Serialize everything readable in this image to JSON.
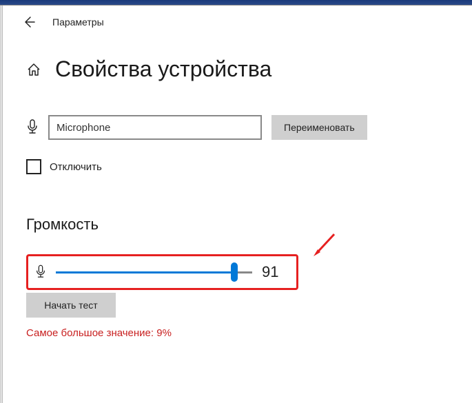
{
  "header": {
    "back_icon": "arrow-left",
    "title": "Параметры"
  },
  "page": {
    "home_icon": "home",
    "heading": "Свойства устройства"
  },
  "device": {
    "icon": "microphone",
    "name_value": "Microphone",
    "rename_label": "Переименовать",
    "disable_checked": false,
    "disable_label": "Отключить"
  },
  "volume": {
    "section_heading": "Громкость",
    "icon": "microphone",
    "value": "91",
    "start_test_label": "Начать тест",
    "result_label": "Самое большое значение: 9%"
  }
}
